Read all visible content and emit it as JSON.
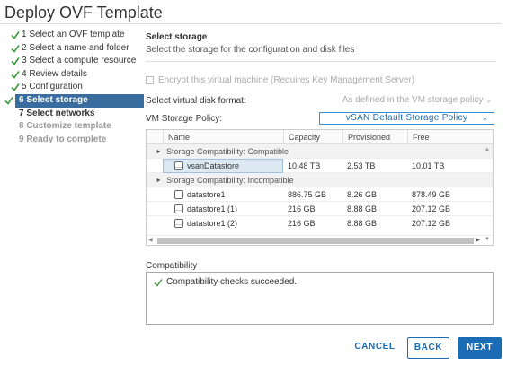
{
  "window": {
    "title": "Deploy OVF Template"
  },
  "steps": [
    {
      "label": "1 Select an OVF template",
      "state": "done"
    },
    {
      "label": "2 Select a name and folder",
      "state": "done"
    },
    {
      "label": "3 Select a compute resource",
      "state": "done"
    },
    {
      "label": "4 Review details",
      "state": "done"
    },
    {
      "label": "5 Configuration",
      "state": "done"
    },
    {
      "label": "6 Select storage",
      "state": "active"
    },
    {
      "label": "7 Select networks",
      "state": "current"
    },
    {
      "label": "8 Customize template",
      "state": "pending"
    },
    {
      "label": "9 Ready to complete",
      "state": "pending"
    }
  ],
  "main": {
    "title": "Select storage",
    "subtitle": "Select the storage for the configuration and disk files",
    "encrypt_label": "Encrypt this virtual machine (Requires Key Management Server)",
    "disk_format_label": "Select virtual disk format:",
    "disk_format_value": "As defined in the VM storage policy",
    "policy_label": "VM Storage Policy:",
    "policy_value": "vSAN Default Storage Policy"
  },
  "table": {
    "columns": [
      "Name",
      "Capacity",
      "Provisioned",
      "Free"
    ],
    "rows": [
      {
        "group": "Storage Compatibility: Compatible"
      },
      {
        "name": "vsanDatastore",
        "capacity": "10.48 TB",
        "provisioned": "2.53 TB",
        "free": "10.01 TB",
        "selected": true
      },
      {
        "group": "Storage Compatibility: Incompatible"
      },
      {
        "name": "datastore1",
        "capacity": "886.75 GB",
        "provisioned": "8.26 GB",
        "free": "878.49 GB"
      },
      {
        "name": "datastore1 (1)",
        "capacity": "216 GB",
        "provisioned": "8.88 GB",
        "free": "207.12 GB"
      },
      {
        "name": "datastore1 (2)",
        "capacity": "216 GB",
        "provisioned": "8.88 GB",
        "free": "207.12 GB"
      }
    ]
  },
  "compatibility": {
    "label": "Compatibility",
    "message": "Compatibility checks succeeded."
  },
  "buttons": {
    "cancel": "CANCEL",
    "back": "BACK",
    "next": "NEXT"
  },
  "colors": {
    "accent": "#1b6bb5",
    "active_step": "#3a6d9f",
    "check_green": "#3c9a3c"
  }
}
